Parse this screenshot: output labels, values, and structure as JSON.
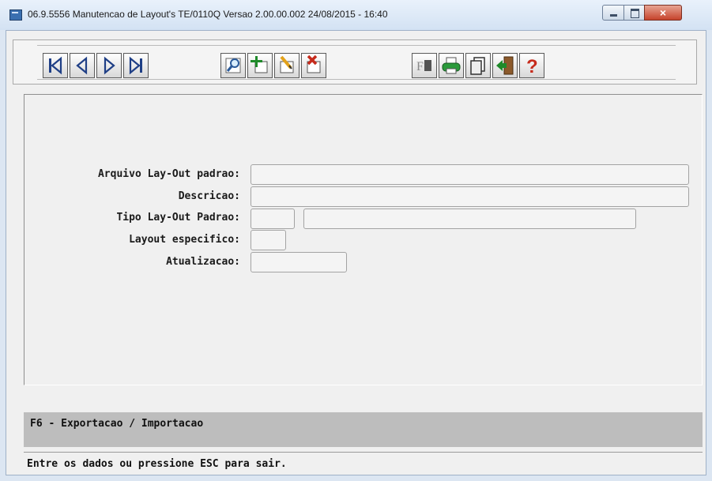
{
  "window": {
    "title": "06.9.5556 Manutencao  de Layout's TE/0110Q Versao 2.00.00.002 24/08/2015 - 16:40",
    "close_glyph": "×"
  },
  "toolbar": {
    "buttons": [
      {
        "name": "first-record-button",
        "icon": "first-record-icon"
      },
      {
        "name": "previous-record-button",
        "icon": "previous-record-icon"
      },
      {
        "name": "next-record-button",
        "icon": "next-record-icon"
      },
      {
        "name": "last-record-button",
        "icon": "last-record-icon"
      },
      {
        "name": "search-button",
        "icon": "magnifier-icon"
      },
      {
        "name": "add-button",
        "icon": "add-icon"
      },
      {
        "name": "modify-button",
        "icon": "edit-icon"
      },
      {
        "name": "delete-button",
        "icon": "delete-icon"
      },
      {
        "name": "filter-button",
        "icon": "filter-icon",
        "label": "F"
      },
      {
        "name": "print-button",
        "icon": "printer-icon"
      },
      {
        "name": "copy-button",
        "icon": "copy-icon"
      },
      {
        "name": "exit-button",
        "icon": "exit-door-icon"
      },
      {
        "name": "help-button",
        "icon": "help-icon",
        "label": "?"
      }
    ]
  },
  "form": {
    "arquivo_label": "Arquivo Lay-Out padrao:",
    "arquivo_value": "",
    "descricao_label": "Descricao:",
    "descricao_value": "",
    "tipo_label": "Tipo Lay-Out Padrao:",
    "tipo_code_value": "",
    "tipo_desc_value": "",
    "especifico_label": "Layout especifico:",
    "especifico_value": "",
    "atualizacao_label": "Atualizacao:",
    "atualizacao_value": ""
  },
  "function_bar": {
    "text": "F6 - Exportacao / Importacao"
  },
  "status_bar": {
    "text": "Entre os dados ou pressione ESC para sair."
  },
  "colors": {
    "navy": "#1f3f86",
    "green": "#1f8a2a",
    "red": "#c62b1c",
    "field_bg": "#f4f4f4"
  }
}
